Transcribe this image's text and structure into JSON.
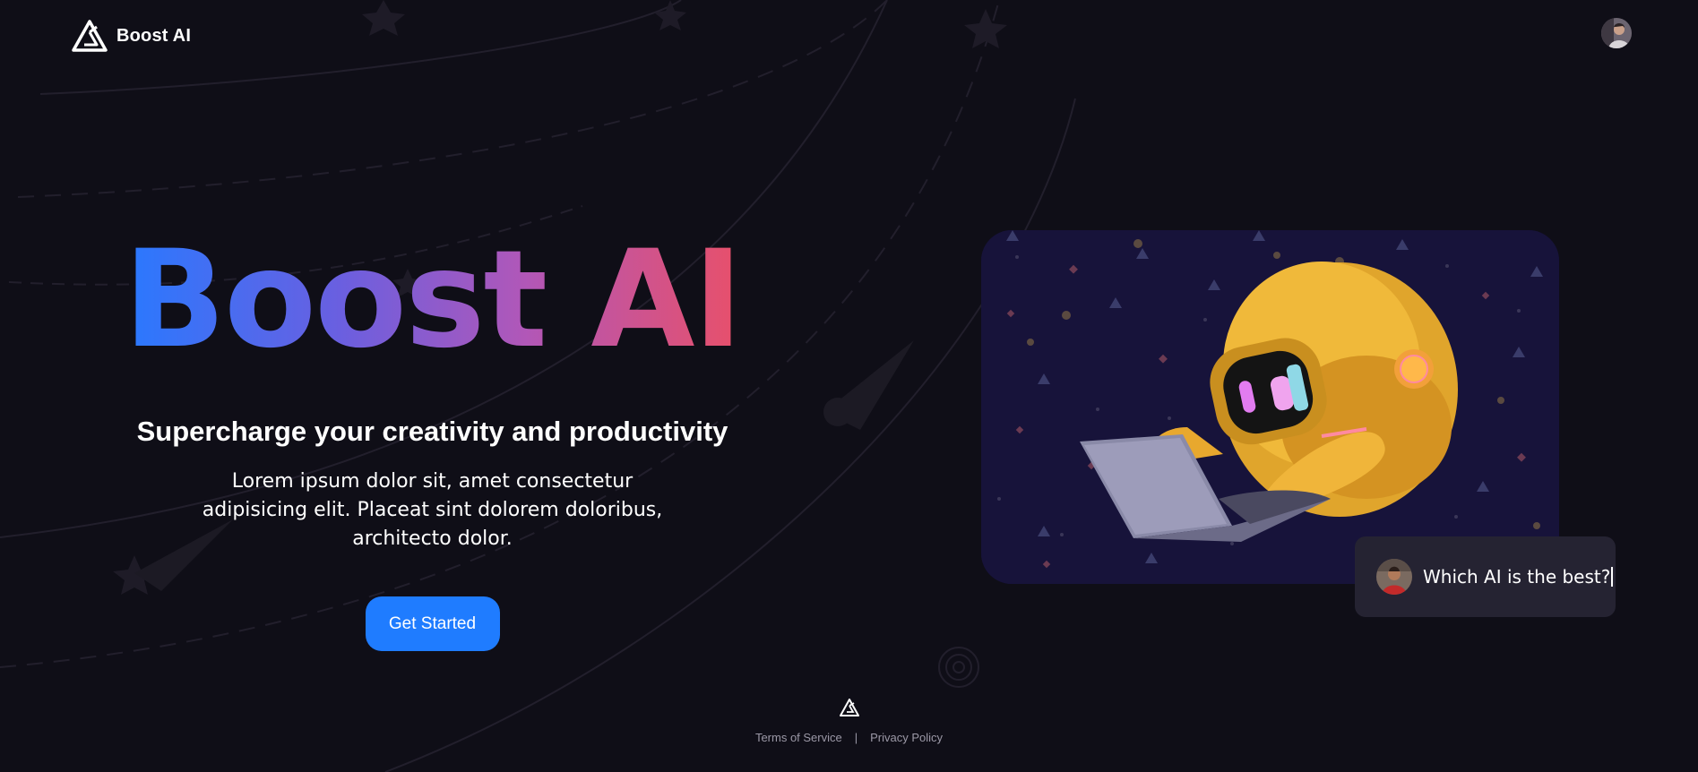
{
  "header": {
    "brand_name": "Boost AI",
    "logo_icon": "triangle-logo-icon",
    "avatar_icon": "user-avatar"
  },
  "hero": {
    "title": "Boost AI",
    "subtitle": "Supercharge your creativity and productivity",
    "description": "Lorem ipsum dolor sit, amet consectetur adipisicing elit. Placeat sint dolorem doloribus, architecto dolor.",
    "cta_label": "Get Started"
  },
  "illustration": {
    "icon": "robot-with-laptop-illustration"
  },
  "chat": {
    "text": "Which AI is the best?",
    "avatar_icon": "user-avatar"
  },
  "footer": {
    "logo_icon": "triangle-logo-icon",
    "links": [
      {
        "label": "Terms of Service"
      },
      {
        "label": "Privacy Policy"
      }
    ],
    "separator": "|"
  },
  "colors": {
    "background": "#0f0e17",
    "accent": "#1f7cff",
    "gradient_start": "#2979ff",
    "gradient_end": "#e8506a",
    "chat_bg": "#252332"
  }
}
